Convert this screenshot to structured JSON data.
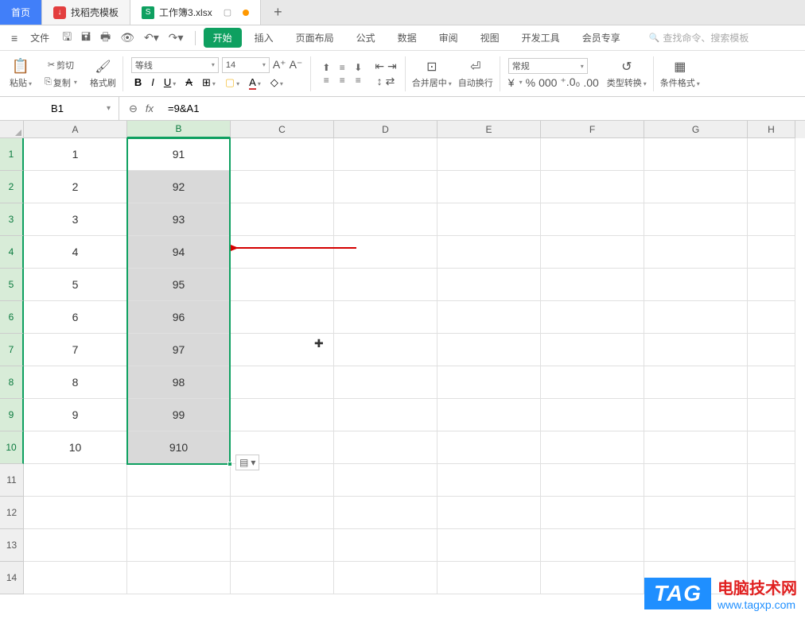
{
  "tabs": {
    "home": "首页",
    "docer": "找稻壳模板",
    "file": "工作簿3.xlsx",
    "add": "+"
  },
  "menu": {
    "file": "文件",
    "items": [
      "开始",
      "插入",
      "页面布局",
      "公式",
      "数据",
      "审阅",
      "视图",
      "开发工具",
      "会员专享"
    ],
    "search_placeholder": "查找命令、搜索模板"
  },
  "toolbar": {
    "paste": "粘贴",
    "cut": "剪切",
    "copy": "复制",
    "format_painter": "格式刷",
    "font_name": "等线",
    "font_size": "14",
    "merge": "合并居中",
    "wrap": "自动换行",
    "number_format": "常规",
    "type_convert": "类型转换",
    "cond_format": "条件格式",
    "currency": "¥",
    "percent": "%",
    "thousand": "000",
    "dec_inc": "⁺.0₀",
    "dec_dec": ".00"
  },
  "formula_bar": {
    "cell_ref": "B1",
    "fx": "fx",
    "formula": "=9&A1"
  },
  "columns": [
    "A",
    "B",
    "C",
    "D",
    "E",
    "F",
    "G",
    "H"
  ],
  "rows": [
    {
      "n": "1",
      "a": "1",
      "b": "91"
    },
    {
      "n": "2",
      "a": "2",
      "b": "92"
    },
    {
      "n": "3",
      "a": "3",
      "b": "93"
    },
    {
      "n": "4",
      "a": "4",
      "b": "94"
    },
    {
      "n": "5",
      "a": "5",
      "b": "95"
    },
    {
      "n": "6",
      "a": "6",
      "b": "96"
    },
    {
      "n": "7",
      "a": "7",
      "b": "97"
    },
    {
      "n": "8",
      "a": "8",
      "b": "98"
    },
    {
      "n": "9",
      "a": "9",
      "b": "99"
    },
    {
      "n": "10",
      "a": "10",
      "b": "910"
    }
  ],
  "empty_rows": [
    "11",
    "12",
    "13",
    "14"
  ],
  "watermark": {
    "tag": "TAG",
    "line1": "电脑技术网",
    "line2": "www.tagxp.com"
  }
}
